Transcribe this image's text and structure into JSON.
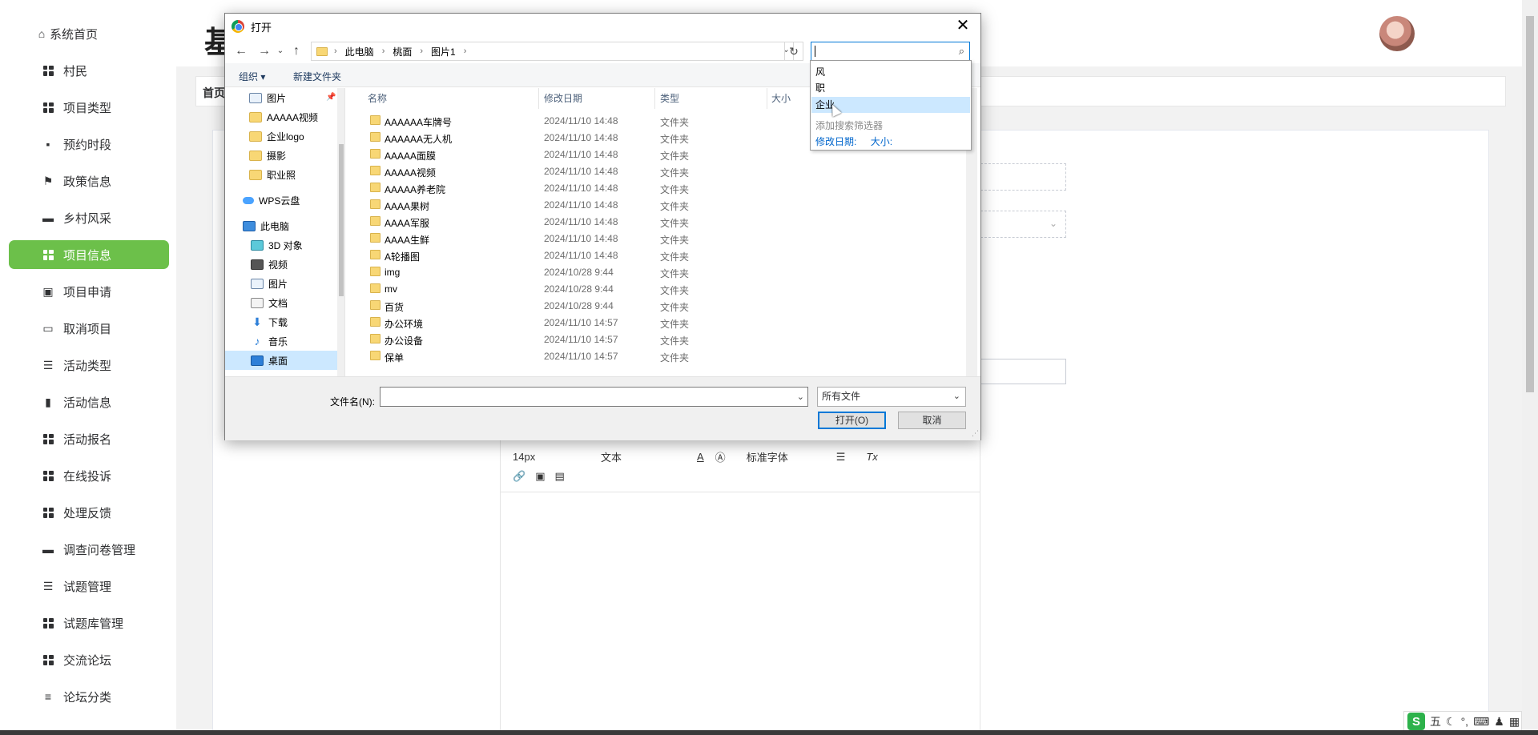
{
  "sidebar": {
    "items": [
      {
        "label": "系统首页",
        "icon": "home-icon"
      },
      {
        "label": "村民",
        "icon": "grid-icon"
      },
      {
        "label": "项目类型",
        "icon": "grid-icon"
      },
      {
        "label": "预约时段",
        "icon": "chat-icon"
      },
      {
        "label": "政策信息",
        "icon": "flag-icon"
      },
      {
        "label": "乡村风采",
        "icon": "briefcase-icon"
      },
      {
        "label": "项目信息",
        "icon": "grid-icon",
        "active": true
      },
      {
        "label": "项目申请",
        "icon": "clipboard-icon"
      },
      {
        "label": "取消项目",
        "icon": "monitor-icon"
      },
      {
        "label": "活动类型",
        "icon": "list-icon"
      },
      {
        "label": "活动信息",
        "icon": "bar-chart-icon"
      },
      {
        "label": "活动报名",
        "icon": "grid-icon"
      },
      {
        "label": "在线投诉",
        "icon": "grid-icon"
      },
      {
        "label": "处理反馈",
        "icon": "grid-icon"
      },
      {
        "label": "调查问卷管理",
        "icon": "bag-icon"
      },
      {
        "label": "试题管理",
        "icon": "list-icon"
      },
      {
        "label": "试题库管理",
        "icon": "grid-icon"
      },
      {
        "label": "交流论坛",
        "icon": "grid-icon"
      },
      {
        "label": "论坛分类",
        "icon": "sliders-icon"
      }
    ],
    "active_color": "#6cc04a"
  },
  "header": {
    "title_partial": "基",
    "breadcrumb_home": "首页"
  },
  "editor": {
    "font_size": "14px",
    "paragraph": "文本",
    "font_family": "标准字体"
  },
  "dialog": {
    "title": "打开",
    "breadcrumb": [
      "此电脑",
      "桃面",
      "图片1"
    ],
    "toolbar": {
      "organize": "组织 ▾",
      "new_folder": "新建文件夹"
    },
    "nav_pane": [
      {
        "label": "图片",
        "icon": "img",
        "pinned": true
      },
      {
        "label": "AAAAA视频",
        "icon": "folder"
      },
      {
        "label": "企业logo",
        "icon": "folder"
      },
      {
        "label": "摄影",
        "icon": "folder"
      },
      {
        "label": "职业照",
        "icon": "folder"
      },
      {
        "label": "WPS云盘",
        "icon": "cloud"
      },
      {
        "label": "此电脑",
        "icon": "pc"
      },
      {
        "label": "3D 对象",
        "icon": "3d"
      },
      {
        "label": "视频",
        "icon": "film"
      },
      {
        "label": "图片",
        "icon": "img"
      },
      {
        "label": "文档",
        "icon": "doc"
      },
      {
        "label": "下载",
        "icon": "dl"
      },
      {
        "label": "音乐",
        "icon": "music"
      },
      {
        "label": "桌面",
        "icon": "desk",
        "selected": true
      }
    ],
    "columns": {
      "name": "名称",
      "date": "修改日期",
      "type": "类型",
      "size": "大小"
    },
    "files": [
      {
        "name": "AAAAAA车牌号",
        "date": "2024/11/10 14:48",
        "type": "文件夹"
      },
      {
        "name": "AAAAAA无人机",
        "date": "2024/11/10 14:48",
        "type": "文件夹"
      },
      {
        "name": "AAAAA面膜",
        "date": "2024/11/10 14:48",
        "type": "文件夹"
      },
      {
        "name": "AAAAA视频",
        "date": "2024/11/10 14:48",
        "type": "文件夹"
      },
      {
        "name": "AAAAA养老院",
        "date": "2024/11/10 14:48",
        "type": "文件夹"
      },
      {
        "name": "AAAA果树",
        "date": "2024/11/10 14:48",
        "type": "文件夹"
      },
      {
        "name": "AAAA军服",
        "date": "2024/11/10 14:48",
        "type": "文件夹"
      },
      {
        "name": "AAAA生鲜",
        "date": "2024/11/10 14:48",
        "type": "文件夹"
      },
      {
        "name": "A轮播图",
        "date": "2024/11/10 14:48",
        "type": "文件夹"
      },
      {
        "name": "img",
        "date": "2024/10/28 9:44",
        "type": "文件夹"
      },
      {
        "name": "mv",
        "date": "2024/10/28 9:44",
        "type": "文件夹"
      },
      {
        "name": "百货",
        "date": "2024/10/28 9:44",
        "type": "文件夹"
      },
      {
        "name": "办公环境",
        "date": "2024/11/10 14:57",
        "type": "文件夹"
      },
      {
        "name": "办公设备",
        "date": "2024/11/10 14:57",
        "type": "文件夹"
      },
      {
        "name": "保单",
        "date": "2024/11/10 14:57",
        "type": "文件夹"
      }
    ],
    "filename_label": "文件名(N):",
    "filename_value": "",
    "filetype": "所有文件",
    "open_btn": "打开(O)",
    "cancel_btn": "取消",
    "search": {
      "suggestions": [
        "风",
        "职",
        "企业"
      ],
      "hint": "添加搜索筛选器",
      "filters": [
        "修改日期:",
        "大小:"
      ]
    }
  },
  "ime": {
    "mode": "五"
  }
}
